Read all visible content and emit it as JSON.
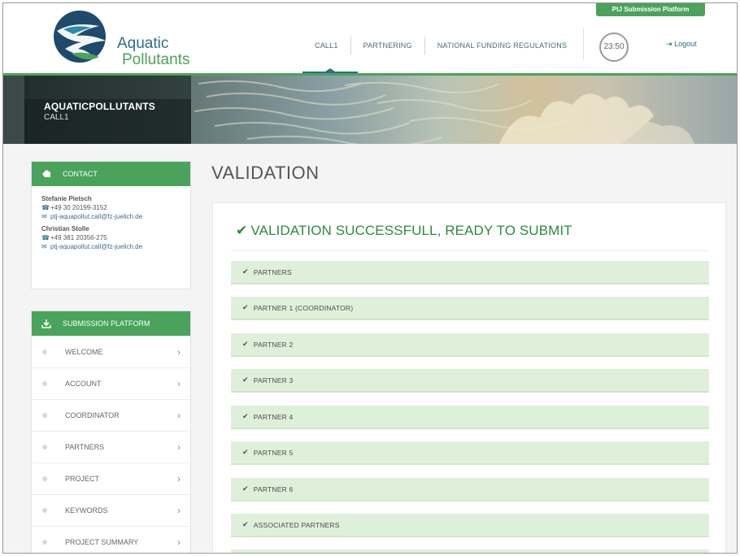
{
  "header": {
    "platform_badge": "PtJ Submission Platform",
    "logo_line1": "Aquatic",
    "logo_line2": "Pollutants",
    "nav": [
      "CALL1",
      "PARTNERING",
      "NATIONAL FUNDING REGULATIONS"
    ],
    "clock": "23:50",
    "logout_label": "Logout"
  },
  "banner": {
    "title": "AQUATICPOLLUTANTS",
    "subtitle": "CALL1"
  },
  "contact": {
    "heading": "CONTACT",
    "people": [
      {
        "name": "Stefanie Pietsch",
        "phone": "+49 30 20199-3152",
        "email": "ptj-aquapollut.call@fz-juelich.de"
      },
      {
        "name": "Christian Stolle",
        "phone": "+49 381 20356-275",
        "email": "ptj-aquapollut.call@fz-juelich.de"
      }
    ]
  },
  "submission": {
    "heading": "SUBMISSION PLATFORM",
    "items": [
      "WELCOME",
      "ACCOUNT",
      "COORDINATOR",
      "PARTNERS",
      "PROJECT",
      "KEYWORDS",
      "PROJECT SUMMARY"
    ]
  },
  "main": {
    "title": "VALIDATION",
    "status": "VALIDATION SUCCESSFULL, READY TO SUBMIT",
    "sections": [
      "PARTNERS",
      "PARTNER 1 (COORDINATOR)",
      "PARTNER 2",
      "PARTNER 3",
      "PARTNER 4",
      "PARTNER 5",
      "PARTNER 6",
      "ASSOCIATED PARTNERS"
    ]
  },
  "colors": {
    "brand_green": "#4aa35a",
    "success_green": "#2e8b3c",
    "section_bg": "#dff0da",
    "link_blue": "#3a6f8e"
  },
  "icons": {
    "check": "check-icon",
    "chevron": "chevron-right-icon",
    "phone": "phone-icon",
    "mail": "mail-icon",
    "logout": "logout-icon"
  }
}
